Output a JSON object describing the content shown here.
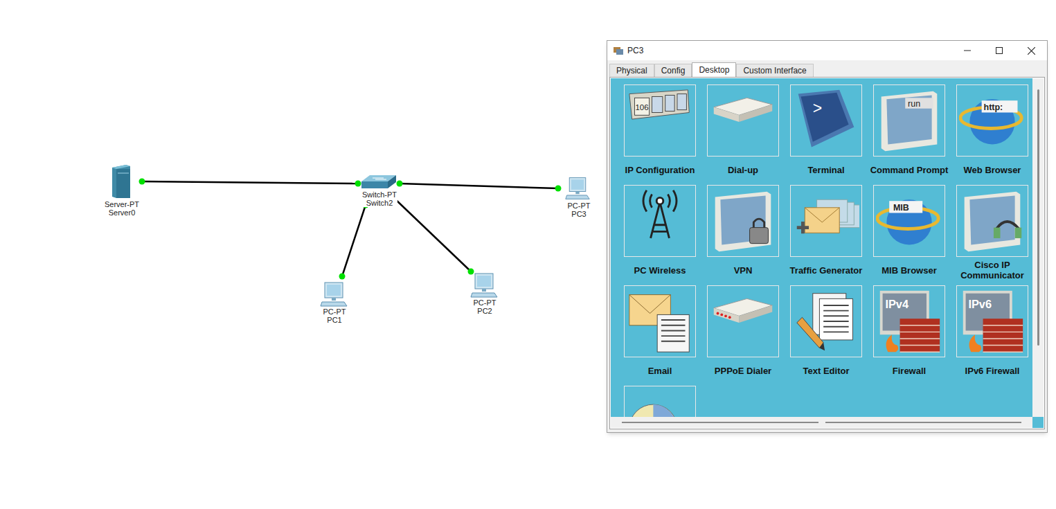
{
  "diagram": {
    "nodes": [
      {
        "kind": "server",
        "labels": [
          "Server-PT",
          "Server0"
        ]
      },
      {
        "kind": "switch",
        "labels": [
          "Switch-PT",
          "Switch2"
        ]
      },
      {
        "kind": "pc",
        "labels": [
          "PC-PT",
          "PC3"
        ]
      },
      {
        "kind": "pc",
        "labels": [
          "PC-PT",
          "PC1"
        ]
      },
      {
        "kind": "pc",
        "labels": [
          "PC-PT",
          "PC2"
        ]
      }
    ],
    "links": [
      {
        "up": true,
        "color": "#00e000"
      },
      {
        "up": true,
        "color": "#00e000"
      },
      {
        "up": true,
        "color": "#00e000"
      },
      {
        "up": true,
        "color": "#00e000"
      }
    ]
  },
  "window": {
    "title": "PC3",
    "tabs": [
      {
        "label": "Physical",
        "selected": false
      },
      {
        "label": "Config",
        "selected": false
      },
      {
        "label": "Desktop",
        "selected": true
      },
      {
        "label": "Custom Interface",
        "selected": false
      }
    ],
    "apps": [
      {
        "kind": "ipconfig",
        "label": "IP Configuration",
        "badge": "106"
      },
      {
        "kind": "dialup",
        "label": "Dial-up"
      },
      {
        "kind": "terminal",
        "label": "Terminal",
        "badge": ">"
      },
      {
        "kind": "cmd",
        "label": "Command Prompt",
        "badge": "run"
      },
      {
        "kind": "browser",
        "label": "Web Browser",
        "badge": "http:"
      },
      {
        "kind": "wireless",
        "label": "PC Wireless"
      },
      {
        "kind": "vpn",
        "label": "VPN"
      },
      {
        "kind": "traffic",
        "label": "Traffic Generator"
      },
      {
        "kind": "mib",
        "label": "MIB Browser",
        "badge": "MIB"
      },
      {
        "kind": "communicator",
        "label": "Cisco IP Communicator"
      },
      {
        "kind": "email",
        "label": "Email"
      },
      {
        "kind": "pppoe",
        "label": "PPPoE Dialer"
      },
      {
        "kind": "editor",
        "label": "Text Editor"
      },
      {
        "kind": "firewall",
        "label": "Firewall",
        "badge": "IPv4"
      },
      {
        "kind": "firewall",
        "label": "IPv6 Firewall",
        "badge": "IPv6"
      },
      {
        "kind": "chart",
        "label": ""
      }
    ]
  }
}
